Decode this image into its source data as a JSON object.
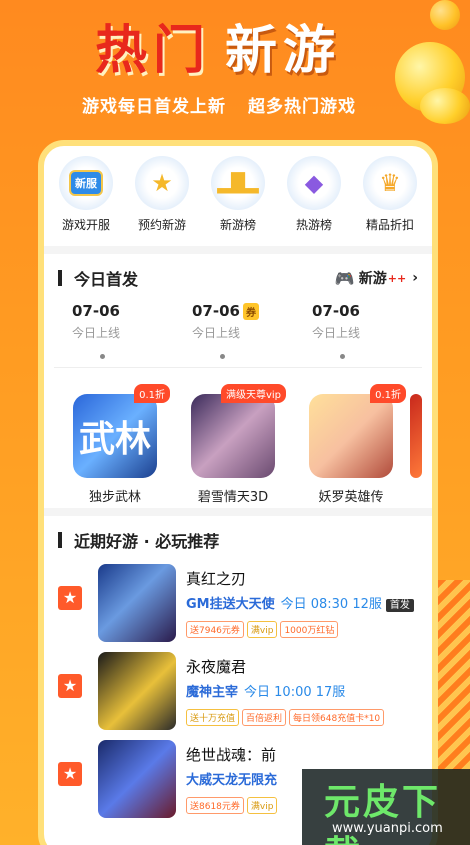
{
  "hero": {
    "title_red": "热门",
    "title_white": "新游",
    "subtitle_a": "游戏每日首发上新",
    "subtitle_b": "超多热门游戏"
  },
  "categories": [
    {
      "label": "游戏开服",
      "icon": "server-badge-icon",
      "badge": "新服"
    },
    {
      "label": "预约新游",
      "icon": "star-trophy-icon"
    },
    {
      "label": "新游榜",
      "icon": "podium-icon"
    },
    {
      "label": "热游榜",
      "icon": "winged-shield-icon"
    },
    {
      "label": "精品折扣",
      "icon": "gold-cup-icon"
    }
  ],
  "today": {
    "title": "今日首发",
    "brand": "新游",
    "brand_plus": "++",
    "dates": [
      {
        "date": "07-06",
        "status": "今日上线"
      },
      {
        "date": "07-06",
        "tag": "券",
        "status": "今日上线"
      },
      {
        "date": "07-06",
        "status": "今日上线"
      }
    ],
    "games": [
      {
        "name": "独步武林",
        "ribbon": "0.1折",
        "art": "武林"
      },
      {
        "name": "碧雪情天3D",
        "ribbon": "满级天尊vip",
        "art": ""
      },
      {
        "name": "妖罗英雄传",
        "ribbon": "0.1折",
        "art": ""
      }
    ]
  },
  "recommend": {
    "title": "近期好游 · 必玩推荐",
    "items": [
      {
        "name": "真红之刃",
        "highlight": "GM挂送大天使",
        "meta": "今日 08:30 12服",
        "badge": "首发",
        "tags": [
          "送7946元券",
          "满vip",
          "1000万红钻"
        ]
      },
      {
        "name": "永夜魔君",
        "highlight": "魔神主宰",
        "meta": "今日 10:00 17服",
        "badge": "",
        "tags": [
          "送十万充值",
          "百倍返利",
          "每日领648充值卡*10"
        ]
      },
      {
        "name": "绝世战魂：前",
        "highlight": "大威天龙无限充",
        "meta": "",
        "badge": "",
        "tags": [
          "送8618元券",
          "满vip",
          ""
        ]
      }
    ]
  },
  "watermark": {
    "text": "元皮下载",
    "url": "www.yuanpi.com"
  }
}
